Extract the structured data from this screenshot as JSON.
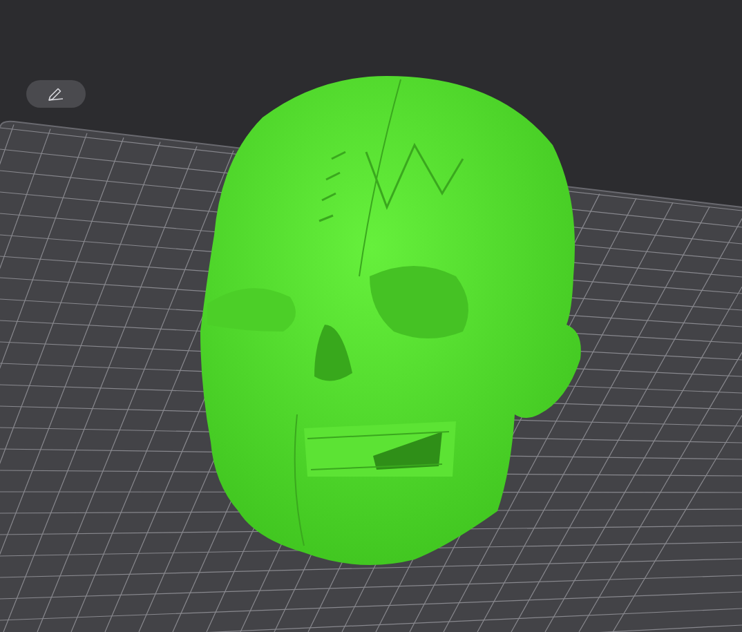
{
  "viewport": {
    "tools": [
      {
        "kind": "edit"
      }
    ],
    "plate": {
      "kind": "grid"
    },
    "model": {
      "kind": "mesh"
    }
  }
}
